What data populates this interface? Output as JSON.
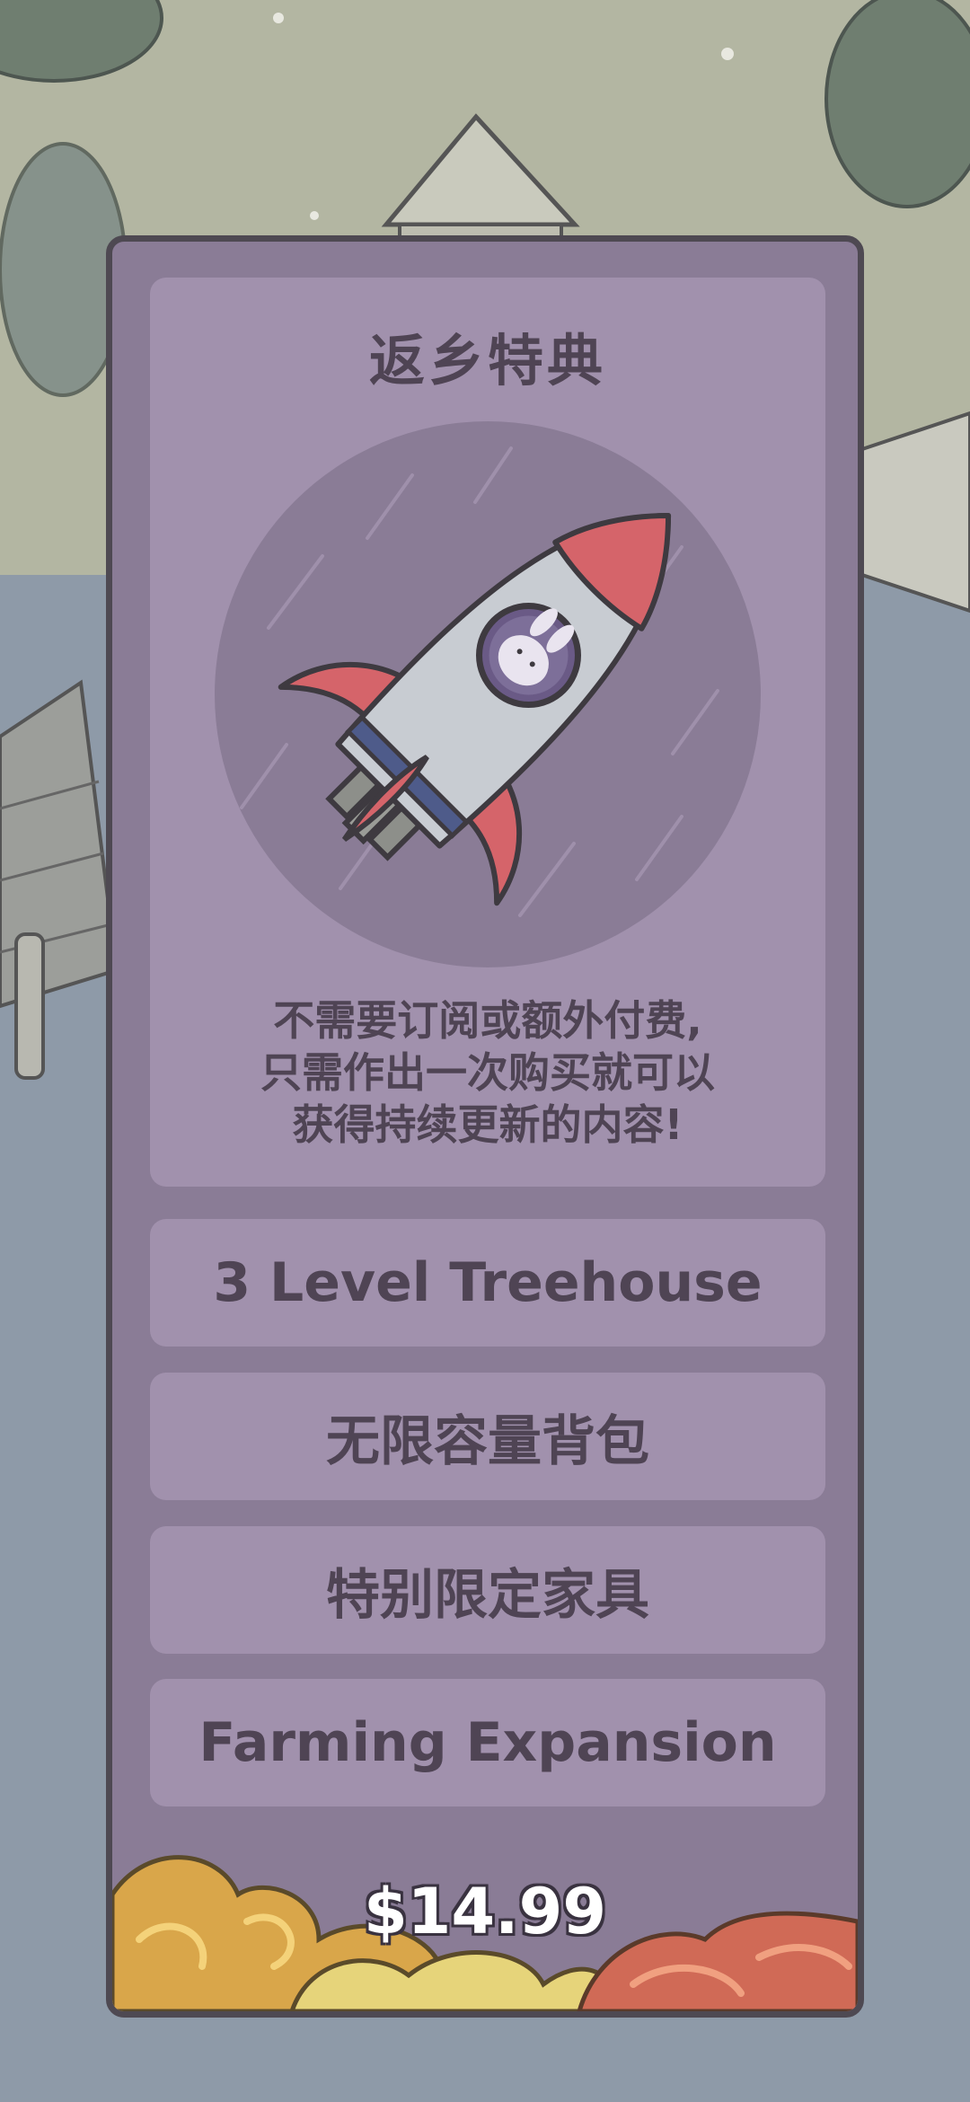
{
  "dialog": {
    "title": "返乡特典",
    "description": "不需要订阅或额外付费,\n只需作出一次购买就可以\n获得持续更新的内容!",
    "illustration": "rocket-with-bunny-icon",
    "features": [
      "3 Level Treehouse",
      "无限容量背包",
      "特别限定家具",
      "Farming Expansion"
    ],
    "price": "$14.99"
  },
  "colors": {
    "card_bg": "#8a7c96",
    "panel_bg": "#a191ad",
    "text": "#4f4454",
    "border": "#4e4952"
  }
}
